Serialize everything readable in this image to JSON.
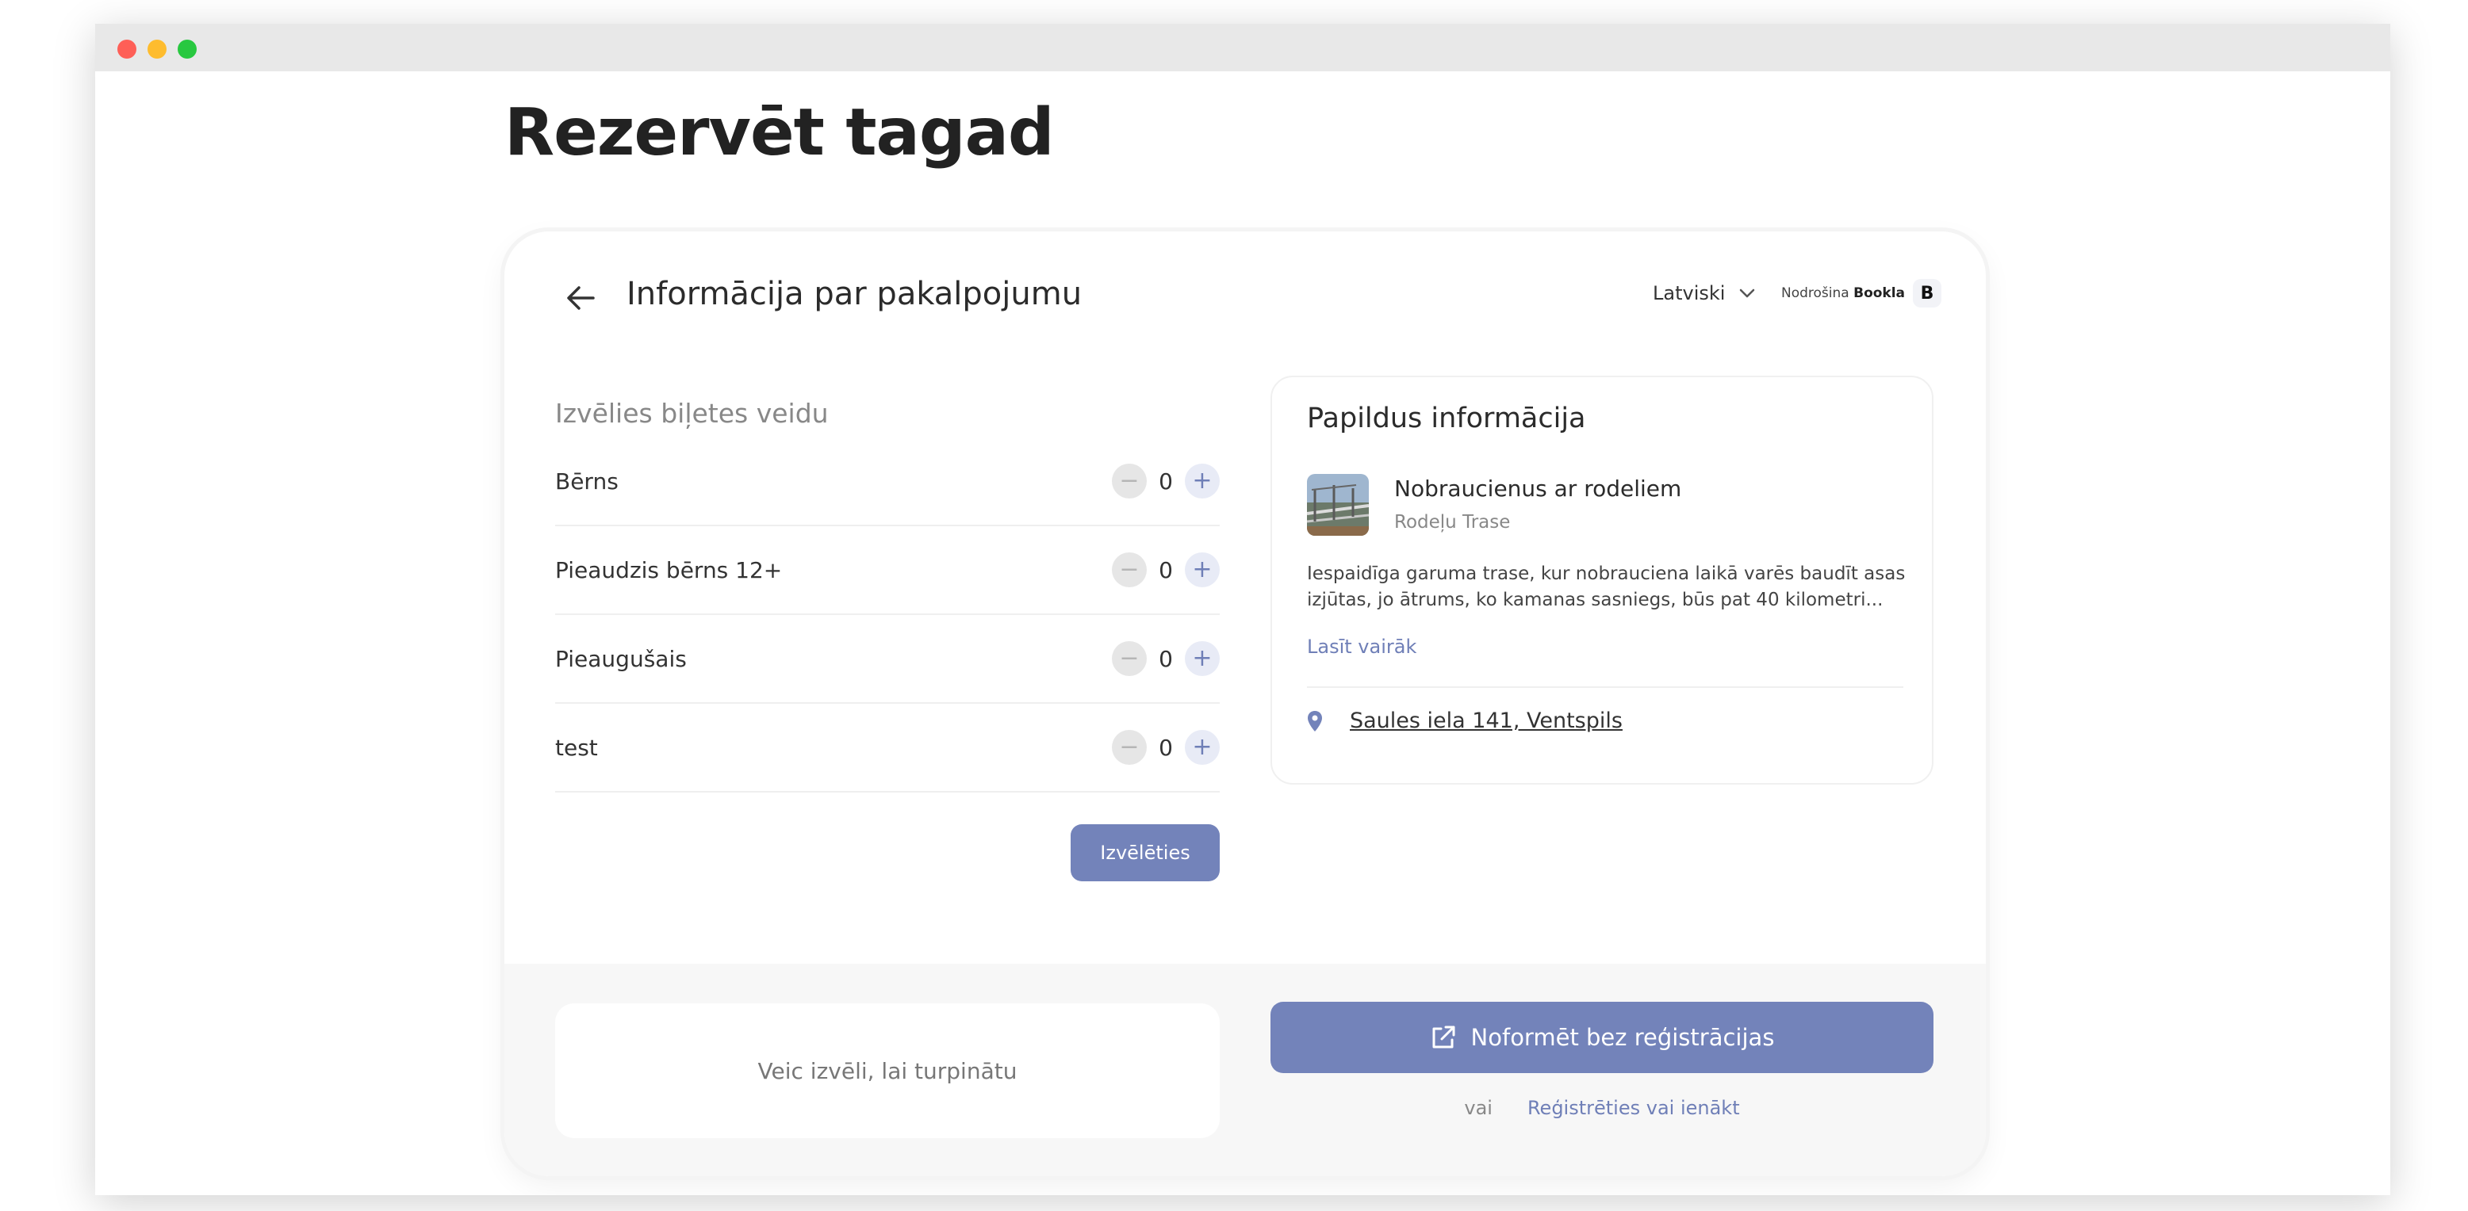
{
  "page": {
    "title": "Rezervēt tagad"
  },
  "card": {
    "title": "Informācija par pakalpojumu",
    "language": "Latviski",
    "powered_by_prefix": "Nodrošina",
    "powered_by_brand": "Bookla",
    "brand_letter": "B"
  },
  "tickets": {
    "section_label": "Izvēlies biļetes veidu",
    "items": [
      {
        "name": "Bērns",
        "count": "0"
      },
      {
        "name": "Pieaudzis bērns 12+",
        "count": "0"
      },
      {
        "name": "Pieaugušais",
        "count": "0"
      },
      {
        "name": "test",
        "count": "0"
      }
    ],
    "choose_label": "Izvēlēties"
  },
  "info": {
    "title": "Papildus informācija",
    "service_name": "Nobraucienus ar rodeliem",
    "service_subtitle": "Rodeļu Trase",
    "description": "Iespaidīga garuma trase, kur nobrauciena laikā varēs baudīt asas izjūtas, jo ātrums, ko kamanas sasniegs, būs pat 40 kilometri...",
    "read_more": "Lasīt vairāk",
    "address": "Saules iela 141, Ventspils"
  },
  "footer": {
    "continue_hint": "Veic izvēli, lai turpinātu",
    "guest_checkout": "Noformēt bez reģistrācijas",
    "or": "vai",
    "login": "Reģistrēties vai ienākt"
  },
  "colors": {
    "accent": "#7383ba",
    "link": "#6f7fb7",
    "title": "#222222"
  }
}
